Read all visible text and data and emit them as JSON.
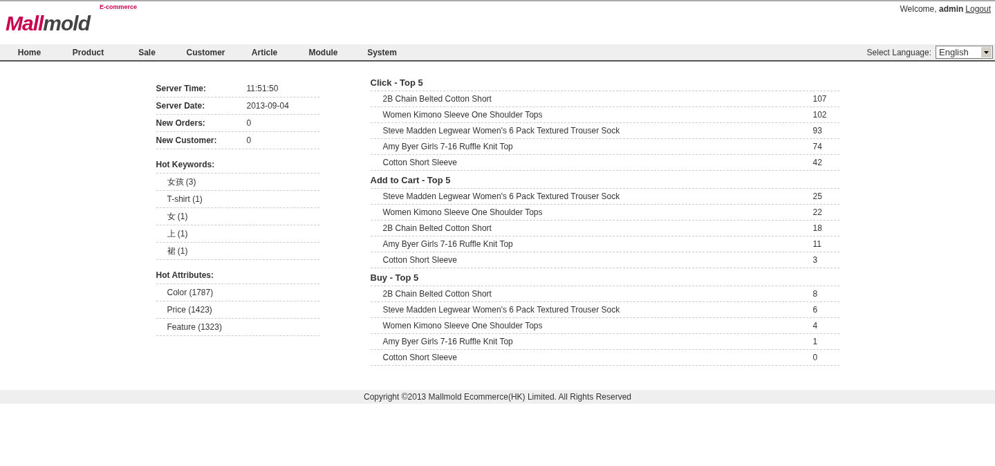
{
  "header": {
    "tagline": "E-commerce",
    "logo": [
      {
        "text": "Mall",
        "color": "#c8004f"
      },
      {
        "text": "mold",
        "color": "#444444"
      }
    ],
    "welcome": "Welcome, **admin**",
    "logout": "Logout"
  },
  "nav": {
    "items": [
      "Home",
      "Product",
      "Sale",
      "Customer",
      "Article",
      "Module",
      "System"
    ],
    "language_label": "Select Language:",
    "language": "English"
  },
  "stats": [
    {
      "label": "Server Time:",
      "value": "11:51:50"
    },
    {
      "label": "Server Date:",
      "value": "2013-09-04"
    },
    {
      "label": "New Orders:",
      "value": "0"
    },
    {
      "label": "New Customer:",
      "value": "0"
    }
  ],
  "lists": [
    {
      "title": "Hot Keywords:",
      "items": [
        "女孩 (3)",
        "T-shirt (1)",
        "女 (1)",
        "上 (1)",
        "裙 (1)"
      ]
    },
    {
      "title": "Hot Attributes:",
      "items": [
        "Color (1787)",
        "Price (1423)",
        "Feature (1323)"
      ]
    }
  ],
  "tops": [
    {
      "title": "Click - Top 5",
      "rows": [
        {
          "name": "2B Chain Belted Cotton Short",
          "count": "107"
        },
        {
          "name": "Women Kimono Sleeve One Shoulder Tops",
          "count": "102"
        },
        {
          "name": "Steve Madden Legwear Women's 6 Pack Textured Trouser Sock",
          "count": "93"
        },
        {
          "name": "Amy Byer Girls 7-16 Ruffle Knit Top",
          "count": "74"
        },
        {
          "name": "Cotton Short Sleeve",
          "count": "42"
        }
      ]
    },
    {
      "title": "Add to Cart - Top 5",
      "rows": [
        {
          "name": "Steve Madden Legwear Women's 6 Pack Textured Trouser Sock",
          "count": "25"
        },
        {
          "name": "Women Kimono Sleeve One Shoulder Tops",
          "count": "22"
        },
        {
          "name": "2B Chain Belted Cotton Short",
          "count": "18"
        },
        {
          "name": "Amy Byer Girls 7-16 Ruffle Knit Top",
          "count": "11"
        },
        {
          "name": "Cotton Short Sleeve",
          "count": "3"
        }
      ]
    },
    {
      "title": "Buy - Top 5",
      "rows": [
        {
          "name": "2B Chain Belted Cotton Short",
          "count": "8"
        },
        {
          "name": "Steve Madden Legwear Women's 6 Pack Textured Trouser Sock",
          "count": "6"
        },
        {
          "name": "Women Kimono Sleeve One Shoulder Tops",
          "count": "4"
        },
        {
          "name": "Amy Byer Girls 7-16 Ruffle Knit Top",
          "count": "1"
        },
        {
          "name": "Cotton Short Sleeve",
          "count": "0"
        }
      ]
    }
  ],
  "footer": "Copyright ©2013 Mallmold Ecommerce(HK) Limited. All Rights Reserved"
}
